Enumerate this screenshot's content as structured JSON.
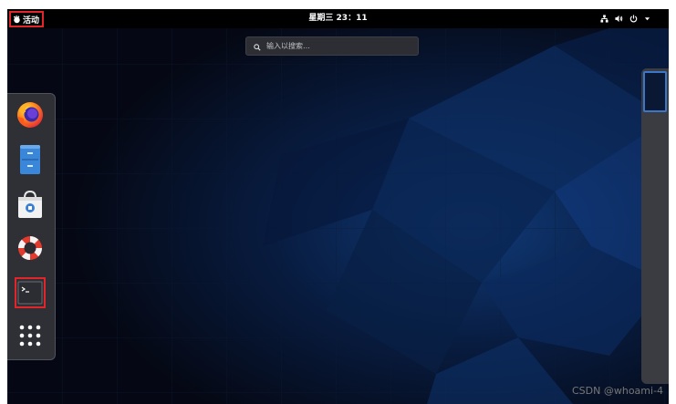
{
  "topbar": {
    "activities_label": "活动",
    "clock": "星期三 23：11",
    "tray_icons": [
      "network-icon",
      "volume-icon",
      "power-icon",
      "chevron-down-icon"
    ]
  },
  "search": {
    "placeholder": "输入以搜索…"
  },
  "dash": {
    "items": [
      "Firefox",
      "Files",
      "Software",
      "Help",
      "Terminal",
      "Show Applications"
    ]
  },
  "watermark": "CSDN @whoami-4",
  "colors": {
    "highlight_border": "#e0262b",
    "topbar_bg": "#000000",
    "accent_blue": "#3a77c8"
  }
}
